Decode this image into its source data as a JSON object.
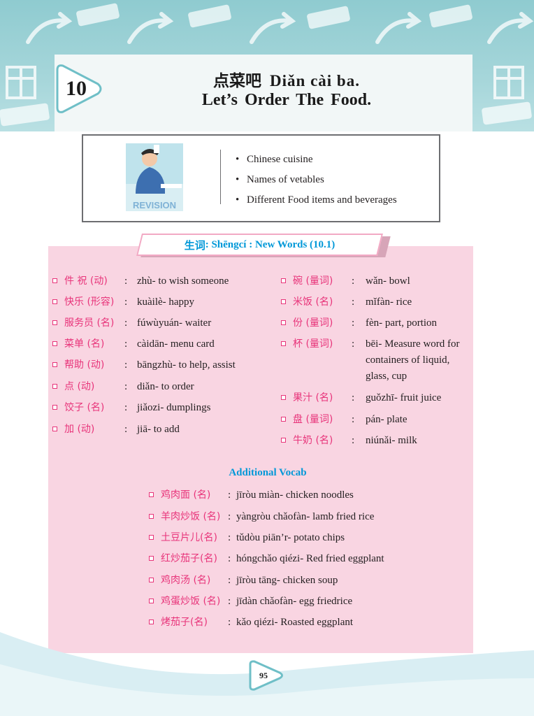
{
  "header": {
    "lesson_number": "10",
    "title_chinese": "点菜吧",
    "title_pinyin": "Diǎn cài ba.",
    "title_english": "Let’s Order The Food."
  },
  "revision": {
    "image_label": "REVISION",
    "points": [
      "Chinese cuisine",
      "Names of vetables",
      "Different Food items and beverages"
    ]
  },
  "new_words": {
    "heading_cn": "生词",
    "heading_rest": " : Shēngcí : New Words (10.1)",
    "left": [
      {
        "word": "件 祝 (动)",
        "meaning": "zhù- to wish someone"
      },
      {
        "word": "快乐 (形容)",
        "meaning": "kuàilè- happy"
      },
      {
        "word": "服务员 (名)",
        "meaning": "fúwùyuán- waiter"
      },
      {
        "word": "菜单 (名)",
        "meaning": "càidān- menu card"
      },
      {
        "word": "帮助 (动)",
        "meaning": "bāngzhù- to help, assist"
      },
      {
        "word": "点 (动)",
        "meaning": "diǎn- to order"
      },
      {
        "word": "饺子 (名)",
        "meaning": "jiǎozi- dumplings"
      },
      {
        "word": "加 (动)",
        "meaning": "jiā- to add"
      }
    ],
    "right": [
      {
        "word": "碗 (量词)",
        "meaning": "wǎn- bowl"
      },
      {
        "word": "米饭 (名)",
        "meaning": "mǐfàn- rice"
      },
      {
        "word": "份 (量词)",
        "meaning": "fèn- part, portion"
      },
      {
        "word": "杯 (量词)",
        "meaning": "bēi- Measure word for containers of liquid, glass, cup"
      },
      {
        "word": "果汁 (名)",
        "meaning": "guǒzhī- fruit juice"
      },
      {
        "word": "盘 (量词)",
        "meaning": "pán- plate"
      },
      {
        "word": "牛奶 (名)",
        "meaning": "niúnǎi- milk"
      }
    ]
  },
  "additional_vocab": {
    "heading": "Additional Vocab",
    "items": [
      {
        "word": "鸡肉面 (名)",
        "meaning": "jīròu miàn- chicken noodles"
      },
      {
        "word": "羊肉炒饭 (名)",
        "meaning": "yàngròu chǎofàn- lamb fried rice"
      },
      {
        "word": "土豆片儿(名)",
        "meaning": "tǔdòu piān’r- potato chips"
      },
      {
        "word": "红炒茄子(名)",
        "meaning": "hóngchǎo qiézi- Red fried eggplant"
      },
      {
        "word": "鸡肉汤 (名)",
        "meaning": "jīròu tāng- chicken soup"
      },
      {
        "word": "鸡蛋炒饭 (名)",
        "meaning": "jīdàn chǎofàn- egg friedrice"
      },
      {
        "word": "烤茄子(名)",
        "meaning": "kǎo qiézi- Roasted eggplant"
      }
    ]
  },
  "footer": {
    "page_number": "95"
  },
  "colors": {
    "accent_pink": "#e8347a",
    "accent_blue": "#0098d8",
    "panel_pink": "#f9d5e2",
    "banner_teal": "#9fd3d7"
  }
}
